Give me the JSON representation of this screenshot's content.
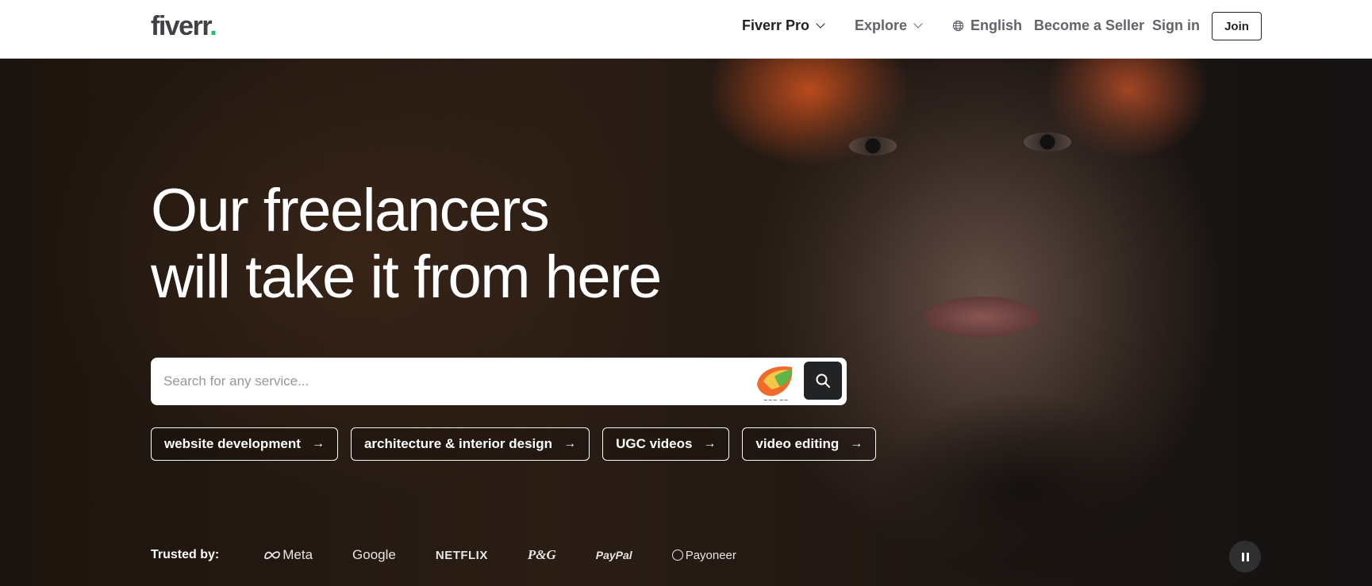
{
  "header": {
    "logo_text": "fiverr",
    "logo_dot": ".",
    "nav": {
      "pro": "Fiverr Pro",
      "explore": "Explore",
      "language": "English",
      "become_seller": "Become a Seller",
      "sign_in": "Sign in",
      "join": "Join"
    }
  },
  "hero": {
    "headline_line1": "Our freelancers",
    "headline_line2": "will take it from here",
    "search": {
      "placeholder": "Search for any service..."
    },
    "chips": [
      {
        "label": "website development",
        "arrow": "→"
      },
      {
        "label": "architecture & interior design",
        "arrow": "→"
      },
      {
        "label": "UGC videos",
        "arrow": "→"
      },
      {
        "label": "video editing",
        "arrow": "→"
      }
    ],
    "trusted_by": {
      "label": "Trusted by:",
      "brands": [
        "Meta",
        "Google",
        "NETFLIX",
        "P&G",
        "PayPal",
        "Payoneer"
      ]
    }
  },
  "colors": {
    "brand_green": "#1dbf73",
    "text_dark": "#222325",
    "text_gray": "#62646a"
  },
  "icons": [
    "chevron-down-icon",
    "globe-icon",
    "search-icon",
    "pause-icon",
    "arrow-right-icon"
  ]
}
